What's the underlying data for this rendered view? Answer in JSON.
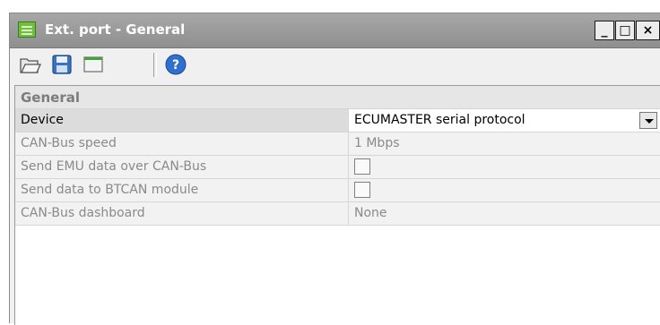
{
  "window": {
    "title": "Ext. port - General",
    "minimize": "_",
    "maximize": "□",
    "close": "×"
  },
  "toolbar": {
    "open_icon": "folder-open-icon",
    "save_icon": "floppy-disk-icon",
    "view_icon": "window-icon",
    "help_icon": "help-icon"
  },
  "grid": {
    "section": "General",
    "rows": [
      {
        "label": "Device",
        "value": "ECUMASTER serial protocol",
        "type": "dropdown"
      },
      {
        "label": "CAN-Bus speed",
        "value": "1 Mbps",
        "type": "text",
        "disabled": true
      },
      {
        "label": "Send EMU data over CAN-Bus",
        "value": "",
        "type": "checkbox",
        "disabled": true
      },
      {
        "label": "Send data to BTCAN module",
        "value": "",
        "type": "checkbox",
        "disabled": true
      },
      {
        "label": "CAN-Bus dashboard",
        "value": "None",
        "type": "text",
        "disabled": true
      }
    ]
  }
}
